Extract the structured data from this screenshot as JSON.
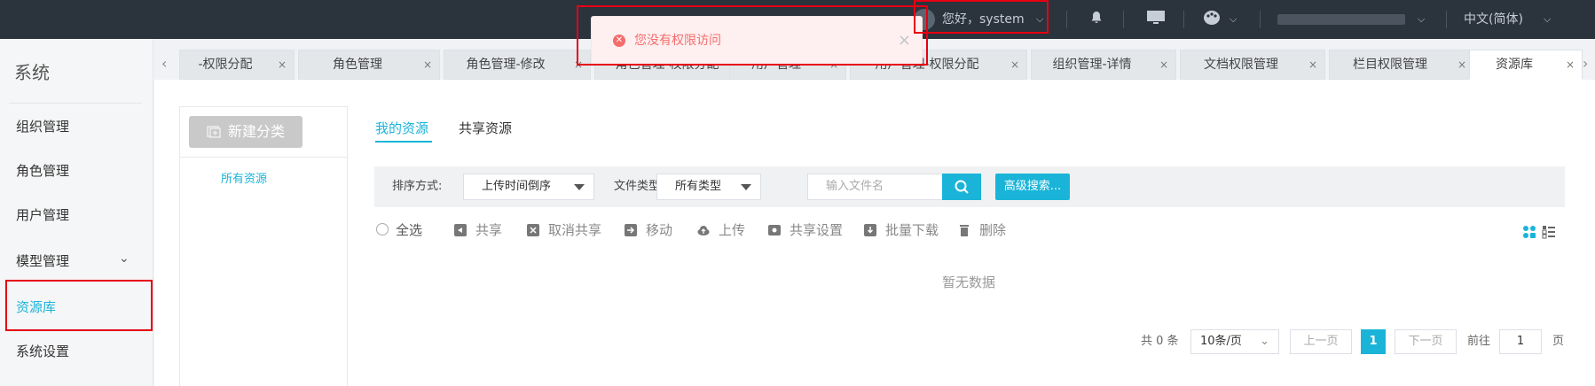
{
  "topbar": {
    "greeting": "您好，system",
    "language": "中文(简体)"
  },
  "notification": {
    "message": "您没有权限访问",
    "close": "×"
  },
  "sidebar": {
    "title": "系统",
    "items": [
      {
        "label": "组织管理"
      },
      {
        "label": "角色管理"
      },
      {
        "label": "用户管理"
      },
      {
        "label": "模型管理"
      },
      {
        "label": "资源库"
      },
      {
        "label": "系统设置"
      }
    ]
  },
  "tabs": [
    {
      "label": "-权限分配"
    },
    {
      "label": "角色管理"
    },
    {
      "label": "角色管理-修改"
    },
    {
      "label": "角色管理-权限分配"
    },
    {
      "label": "用户管理"
    },
    {
      "label": "用户管理-权限分配"
    },
    {
      "label": "组织管理-详情"
    },
    {
      "label": "文档权限管理"
    },
    {
      "label": "栏目权限管理"
    },
    {
      "label": "资源库"
    }
  ],
  "tab_close": "×",
  "tab_nav": {
    "left": "‹",
    "right": "›"
  },
  "left_panel": {
    "new_button": "新建分类",
    "all_resources": "所有资源"
  },
  "resource_tabs": [
    {
      "label": "我的资源"
    },
    {
      "label": "共享资源"
    }
  ],
  "filter": {
    "sort_label": "排序方式:",
    "sort_value": "上传时间倒序",
    "type_label": "文件类型:",
    "type_value": "所有类型",
    "search_placeholder": "输入文件名",
    "advanced_search": "高级搜索..."
  },
  "toolbar": {
    "select_all": "全选",
    "share": "共享",
    "cancel_share": "取消共享",
    "move": "移动",
    "upload": "上传",
    "share_settings": "共享设置",
    "batch_download": "批量下载",
    "delete": "删除"
  },
  "empty_text": "暂无数据",
  "pagination": {
    "total": "共 0 条",
    "page_size": "10条/页",
    "prev": "上一页",
    "current": "1",
    "next": "下一页",
    "goto_label": "前往",
    "goto_value": "1",
    "page_suffix": "页"
  },
  "colors": {
    "accent": "#1ab4d8",
    "topbar": "#2b333d",
    "error": "#f56c6c",
    "highlight_box": "#e60012"
  }
}
